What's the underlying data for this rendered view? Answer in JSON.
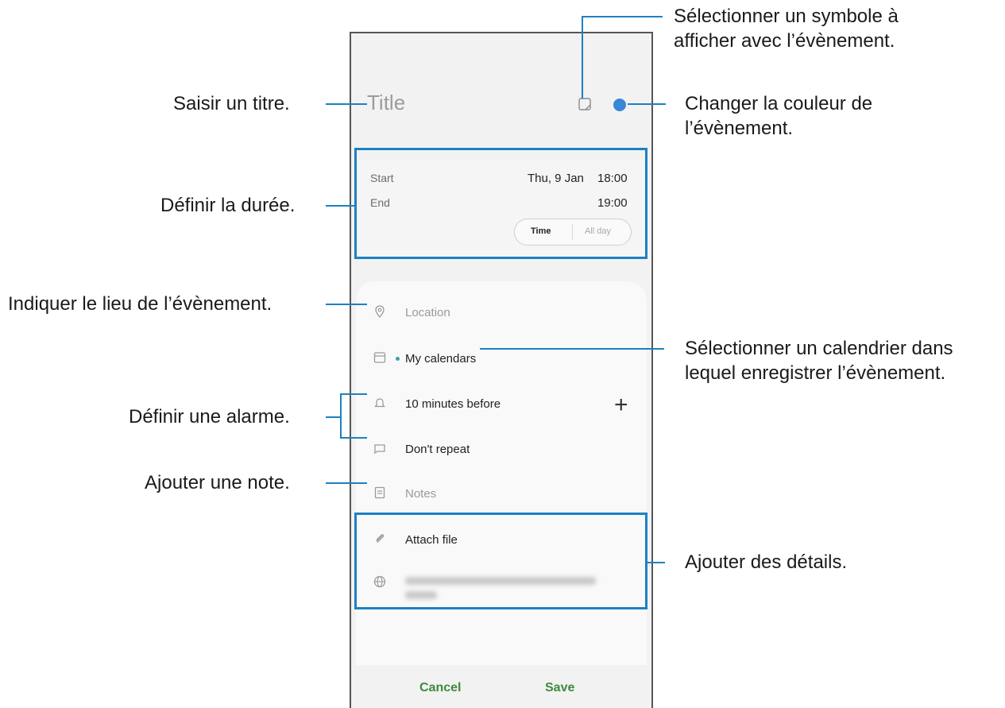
{
  "form": {
    "title_placeholder": "Title",
    "start_label": "Start",
    "start_date": "Thu, 9 Jan",
    "start_time": "18:00",
    "end_label": "End",
    "end_time": "19:00",
    "mode_time": "Time",
    "mode_allday": "All day",
    "location_placeholder": "Location",
    "calendar": "My calendars",
    "alarm": "10 minutes before",
    "repeat": "Don't repeat",
    "notes_placeholder": "Notes",
    "attach": "Attach file",
    "cancel_label": "Cancel",
    "save_label": "Save"
  },
  "annotations": {
    "symbol": [
      "Sélectionner un symbole à",
      "afficher avec l’évènement."
    ],
    "title": "Saisir un titre.",
    "color": [
      "Changer la couleur de",
      "l’évènement."
    ],
    "duration": "Définir la durée.",
    "location": "Indiquer le lieu de l’évènement.",
    "calendar": [
      "Sélectionner un calendrier dans",
      "lequel enregistrer l’évènement."
    ],
    "alarm": "Définir une alarme.",
    "note": "Ajouter une note.",
    "details": "Ajouter des détails."
  },
  "colors": {
    "accent": "#1d80c4",
    "event_color": "#3a86d6",
    "button_text": "#3f8a3f"
  },
  "icons": [
    "sticker-icon",
    "location-pin-icon",
    "calendar-icon",
    "bell-icon",
    "repeat-icon",
    "notes-icon",
    "paperclip-icon",
    "globe-icon",
    "plus-icon"
  ]
}
